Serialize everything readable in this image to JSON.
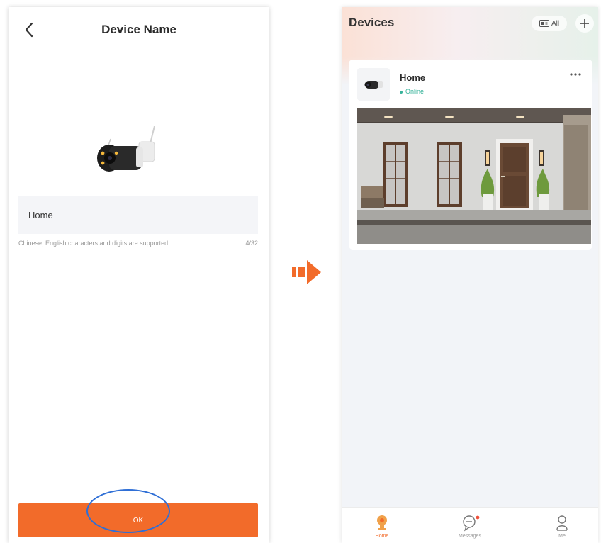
{
  "left_screen": {
    "nav_title": "Device Name",
    "name_field": {
      "value": "Home"
    },
    "hint": "Chinese, English characters and digits are supported",
    "counter": "4/32",
    "ok_label": "OK"
  },
  "right_screen": {
    "title": "Devices",
    "filter_label": "All",
    "device": {
      "name": "Home",
      "status": "Online"
    },
    "tabs": [
      {
        "label": "Home",
        "icon": "home-icon",
        "active": true
      },
      {
        "label": "Messages",
        "icon": "messages-icon",
        "has_badge": true
      },
      {
        "label": "Me",
        "icon": "person-icon"
      }
    ]
  },
  "colors": {
    "accent": "#f26b2a",
    "online": "#37b39a",
    "highlight_ring": "#2f6fd6",
    "badge": "#f0503a"
  }
}
